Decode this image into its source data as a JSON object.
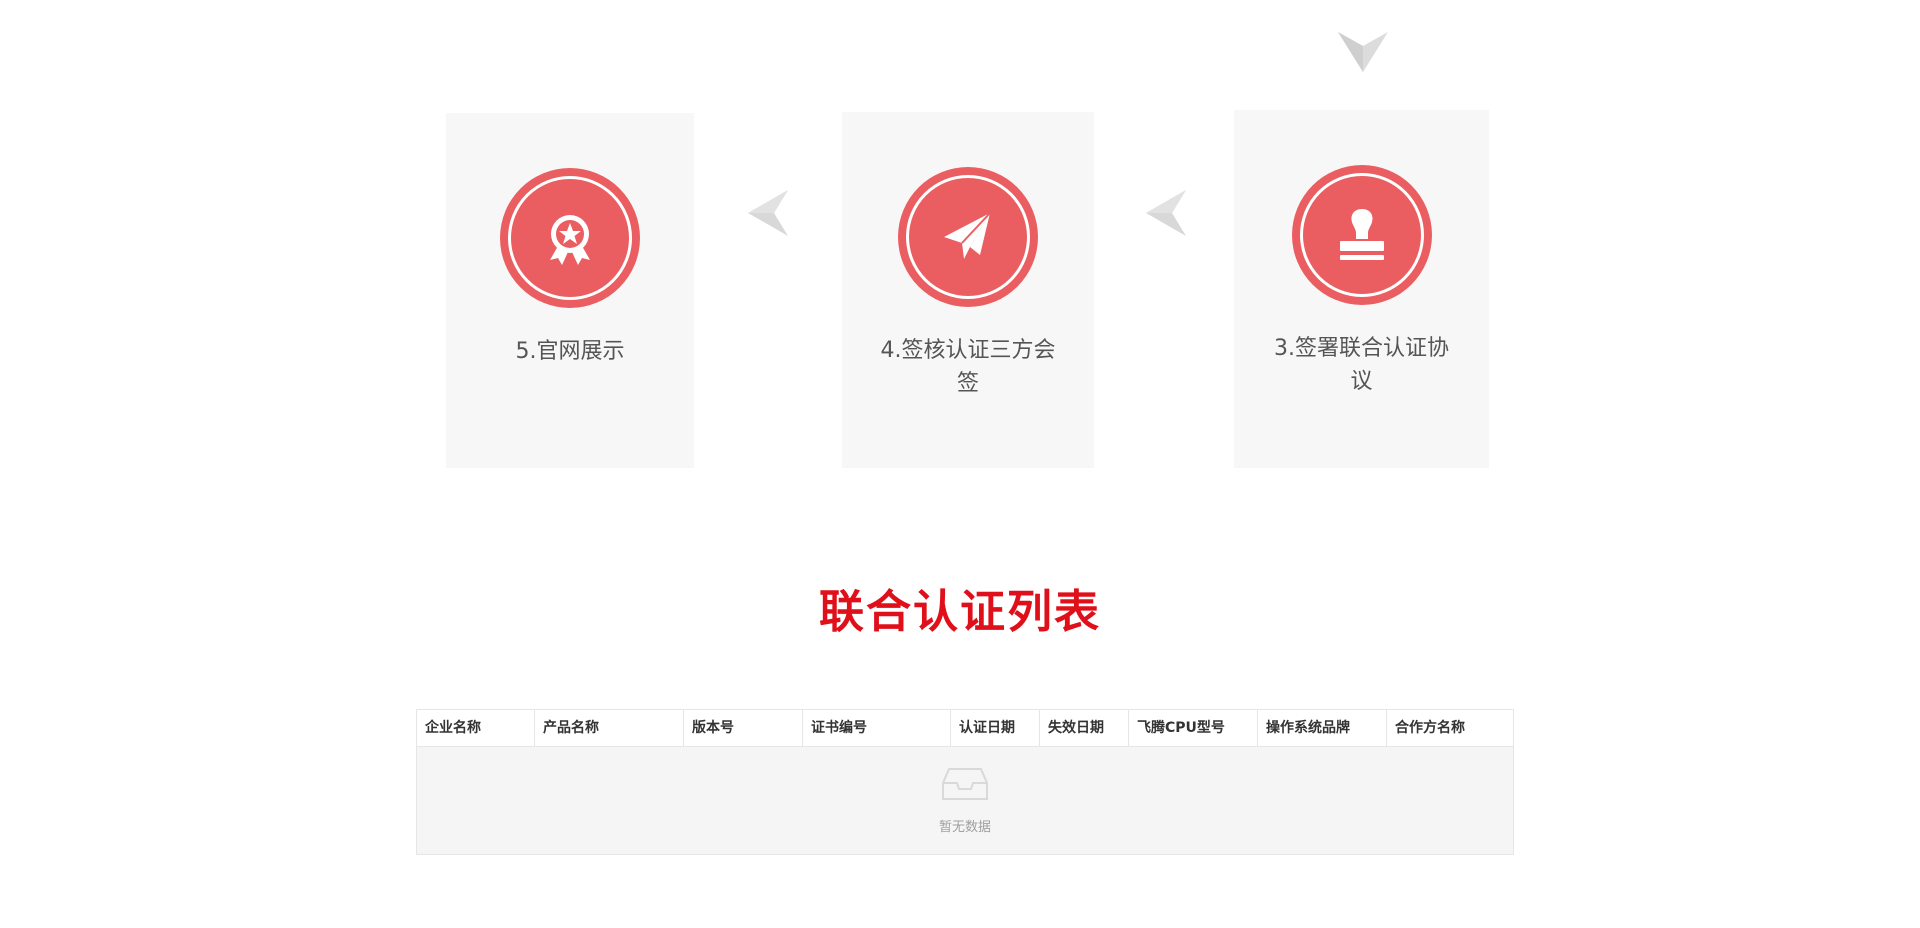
{
  "steps": [
    {
      "label": "5.官网展示",
      "icon": "award-ribbon-icon"
    },
    {
      "label": "4.签核认证三方会签",
      "icon": "paper-plane-icon"
    },
    {
      "label": "3.签署联合认证协议",
      "icon": "stamp-icon"
    }
  ],
  "section": {
    "title": "联合认证列表"
  },
  "table": {
    "columns": [
      "企业名称",
      "产品名称",
      "版本号",
      "证书编号",
      "认证日期",
      "失效日期",
      "飞腾CPU型号",
      "操作系统品牌",
      "合作方名称"
    ],
    "empty_text": "暂无数据"
  },
  "colors": {
    "accent": "#ea5e61",
    "title": "#e0101b",
    "card_bg": "#f7f7f7",
    "arrow": "#d8d8d8"
  }
}
